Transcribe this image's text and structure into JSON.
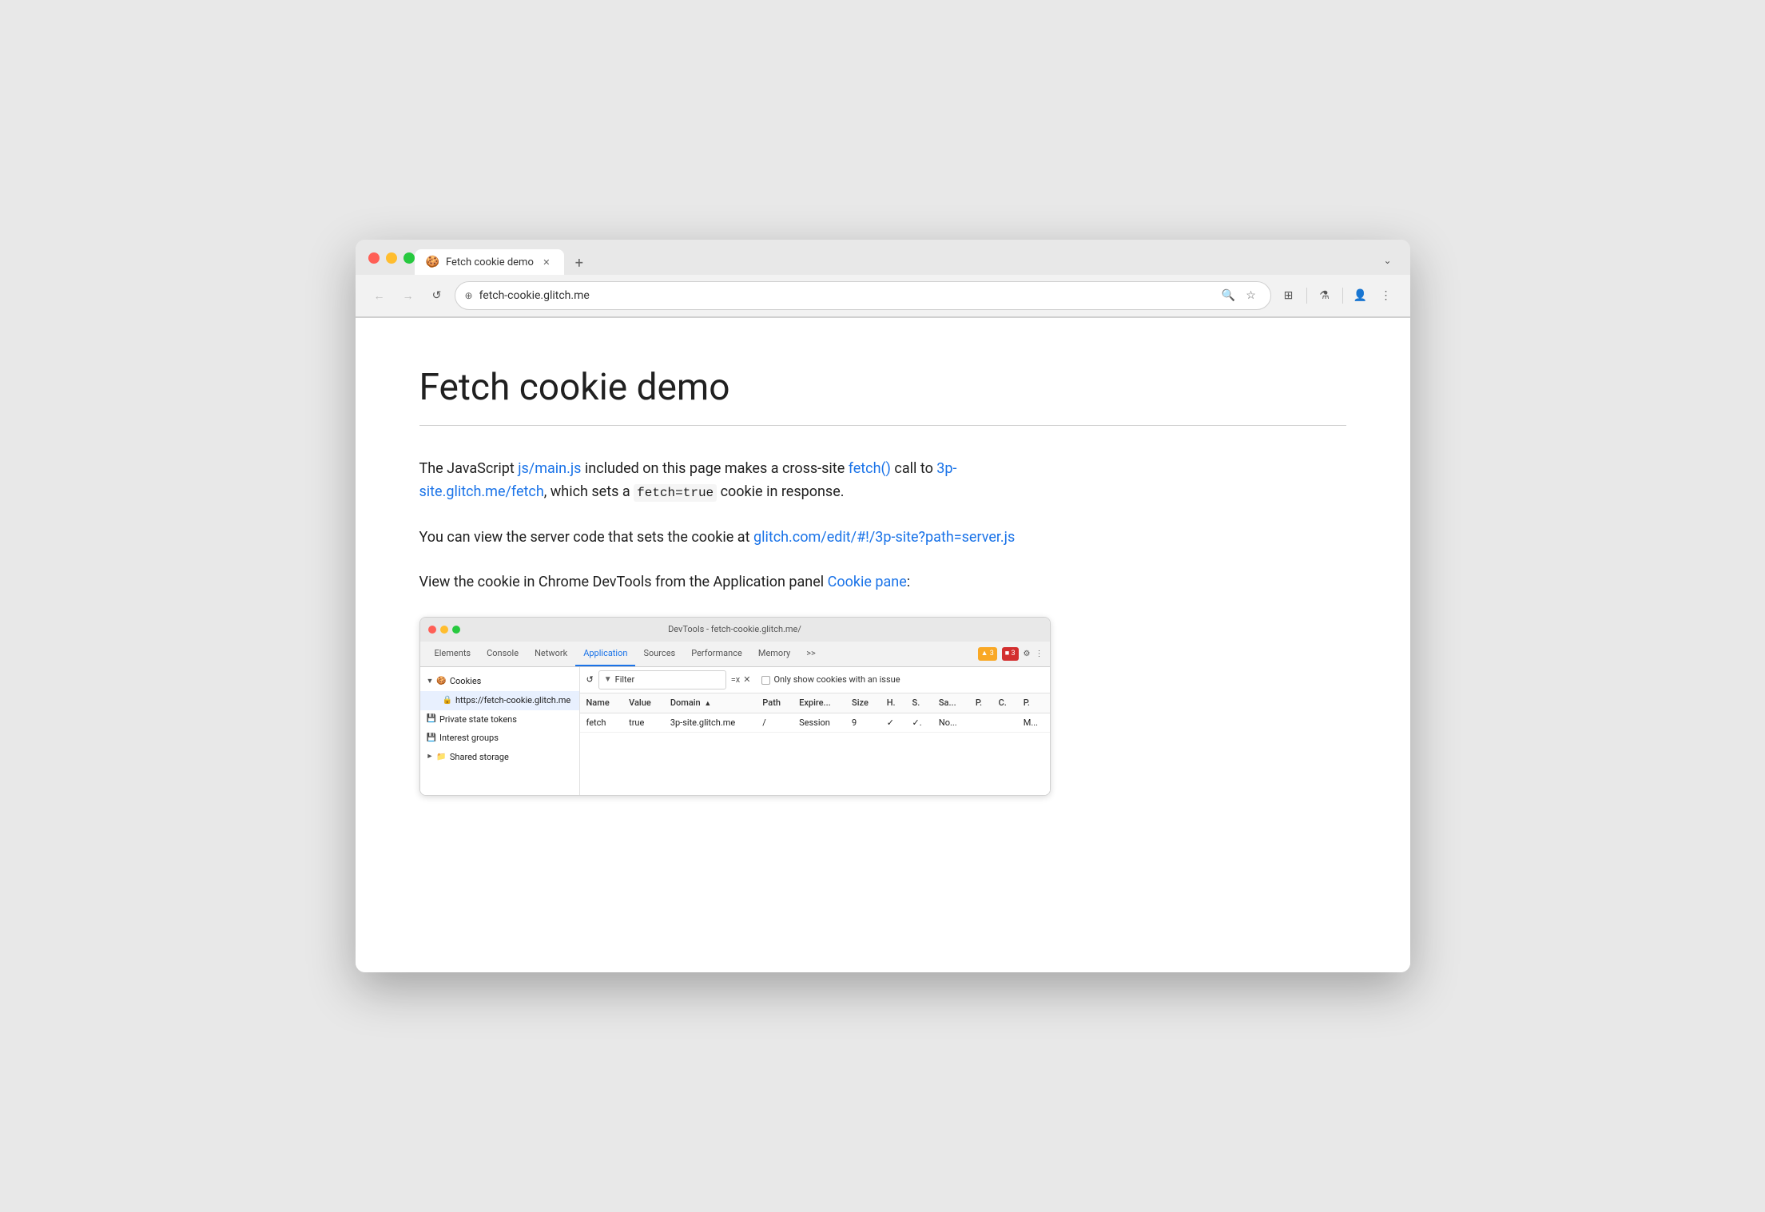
{
  "browser": {
    "tab_title": "Fetch cookie demo",
    "tab_favicon": "🍪",
    "tab_close": "✕",
    "new_tab": "+",
    "dropdown": "⌄",
    "address": "fetch-cookie.glitch.me",
    "back_btn": "←",
    "forward_btn": "→",
    "reload_btn": "↺",
    "site_info_icon": "⊕",
    "search_icon": "🔍",
    "bookmark_icon": "☆",
    "extensions_icon": "⊞",
    "lab_icon": "⚗",
    "profile_icon": "👤",
    "menu_icon": "⋮"
  },
  "page": {
    "title": "Fetch cookie demo",
    "paragraph1_before": "The JavaScript ",
    "paragraph1_link1": "js/main.js",
    "paragraph1_link1_url": "js/main.js",
    "paragraph1_middle": " included on this page makes a cross-site ",
    "paragraph1_link2": "fetch()",
    "paragraph1_link2_url": "https://developer.mozilla.org/en-US/docs/Web/API/fetch",
    "paragraph1_after": " call to ",
    "paragraph1_link3": "3p-site.glitch.me/fetch",
    "paragraph1_link3_url": "https://3p-site.glitch.me/fetch",
    "paragraph1_end": ", which sets a ",
    "code1": "fetch=true",
    "paragraph1_final": " cookie in response.",
    "paragraph2_before": "You can view the server code that sets the cookie at ",
    "paragraph2_link": "glitch.com/edit/#!/3p-site?path=server.js",
    "paragraph2_link_url": "https://glitch.com/edit/#!/3p-site?path=server.js",
    "paragraph3": "View the cookie in Chrome DevTools from the Application panel ",
    "paragraph3_link": "Cookie pane",
    "paragraph3_colon": ":"
  },
  "devtools": {
    "window_title": "DevTools - fetch-cookie.glitch.me/",
    "tabs": [
      "Elements",
      "Console",
      "Network",
      "Application",
      "Sources",
      "Performance",
      "Memory",
      "»"
    ],
    "active_tab": "Application",
    "warn_count": "▲ 3",
    "err_count": "■ 3",
    "settings_icon": "⚙",
    "menu_icon": "⋮",
    "reload_icon": "↺",
    "filter_placeholder": "Filter",
    "clear_icon": "=x",
    "delete_icon": "✕",
    "only_issues_label": "Only show cookies with an issue",
    "sidebar": {
      "items": [
        {
          "label": "Cookies",
          "type": "parent",
          "arrow": "▼",
          "icon": "🍪"
        },
        {
          "label": "https://fetch-cookie.glitch.me",
          "type": "child",
          "icon": "🔒"
        },
        {
          "label": "Private state tokens",
          "type": "item",
          "icon": "💾"
        },
        {
          "label": "Interest groups",
          "type": "item",
          "icon": "💾"
        },
        {
          "label": "Shared storage",
          "type": "parent-collapsed",
          "arrow": "►",
          "icon": "📁"
        }
      ]
    },
    "table": {
      "headers": [
        "Name",
        "Value",
        "Domain",
        "▲",
        "Path",
        "Expires...",
        "Size",
        "H.",
        "S.",
        "Sa...",
        "P.",
        "C.",
        "P."
      ],
      "rows": [
        {
          "name": "fetch",
          "value": "true",
          "domain": "3p-site.glitch.me",
          "sort": "",
          "path": "/",
          "expires": "Session",
          "size": "9",
          "h": "✓",
          "s": "✓.",
          "sa": "No...",
          "p": "",
          "c": "",
          "p2": "M..."
        }
      ]
    }
  }
}
